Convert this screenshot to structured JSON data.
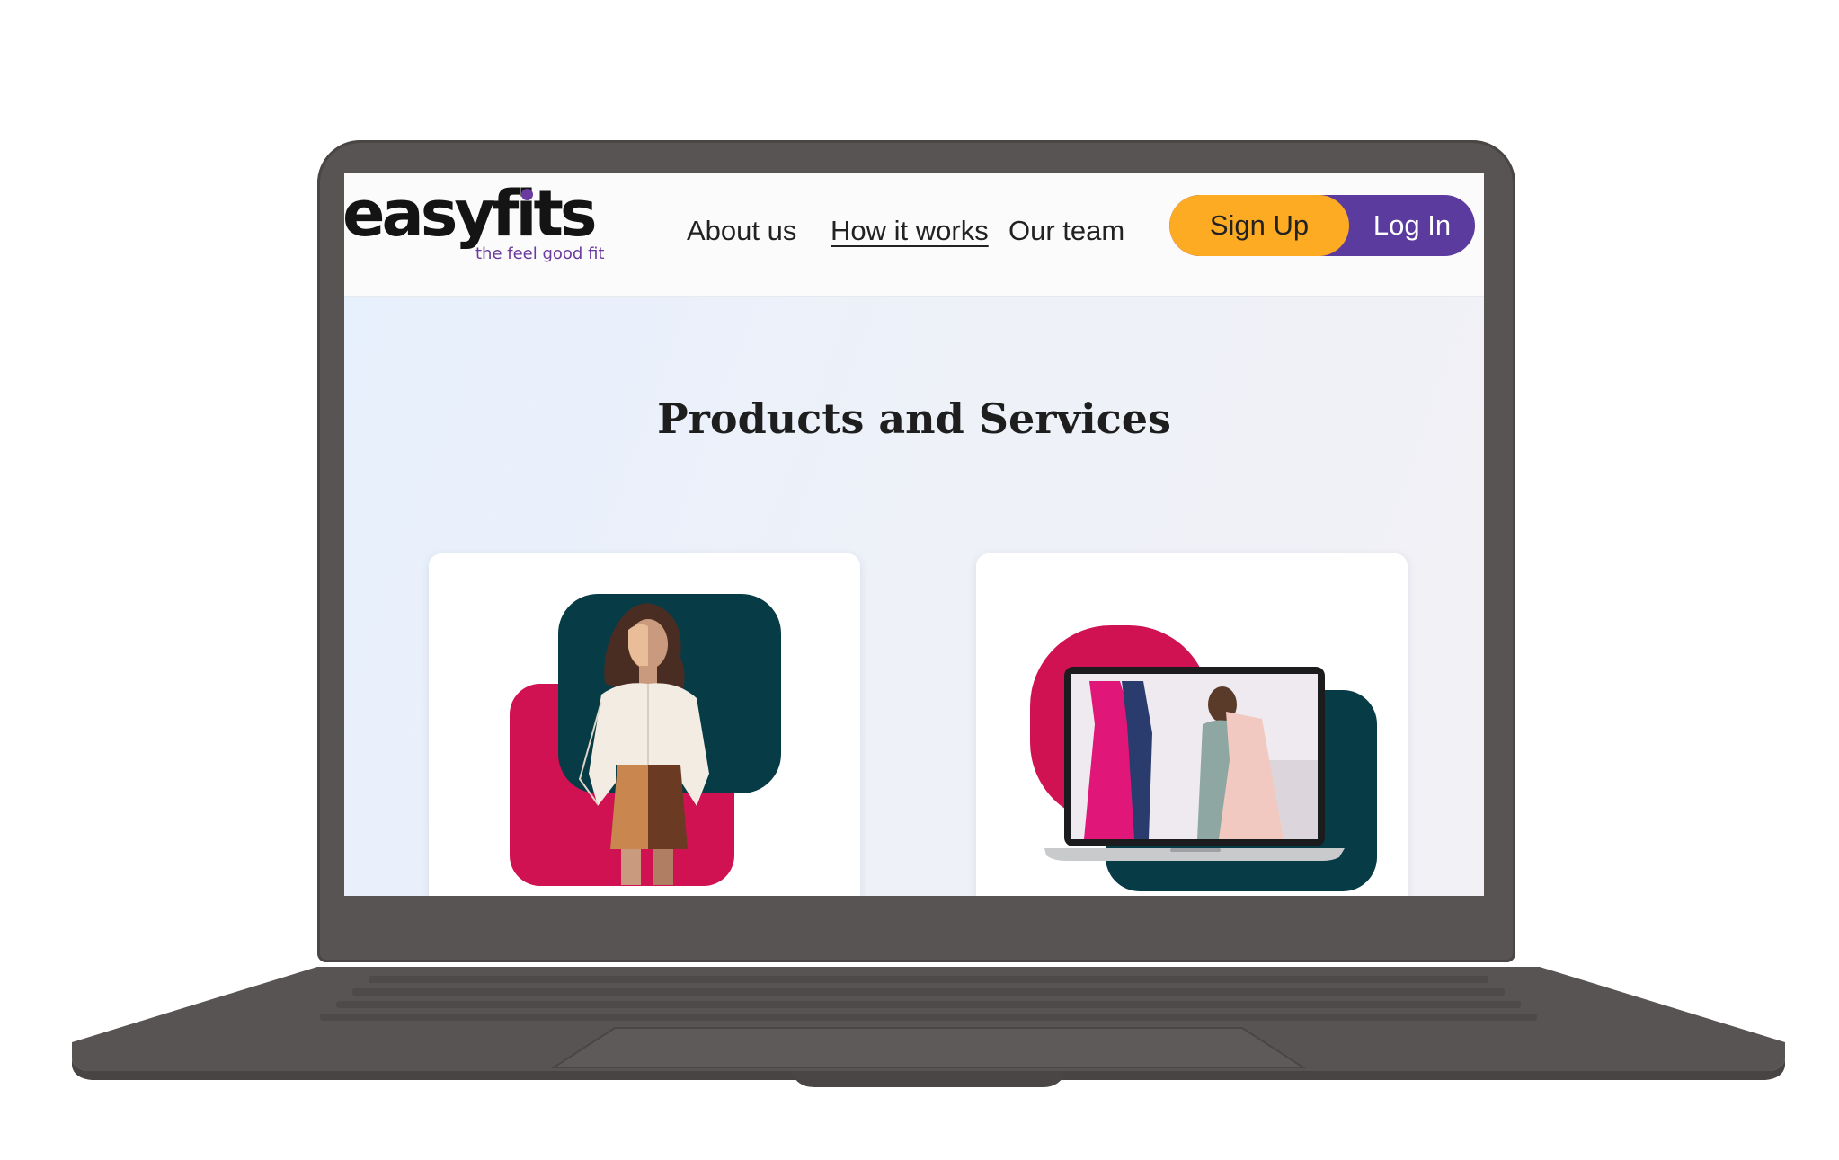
{
  "brand": {
    "name": "easyfits",
    "tagline": "the feel good fit",
    "accent_purple": "#5b3b9d",
    "accent_orange": "#fdab22",
    "accent_crimson": "#d01252",
    "accent_teal": "#073b46"
  },
  "nav": {
    "items": [
      {
        "label": "About us",
        "active": false
      },
      {
        "label": "How it works",
        "active": true
      },
      {
        "label": "Our team",
        "active": false
      }
    ]
  },
  "auth": {
    "signup_label": "Sign Up",
    "login_label": "Log In"
  },
  "main": {
    "section_title": "Products and Services",
    "cards": [
      {
        "image": "virtual-fitting-model-illustration"
      },
      {
        "image": "online-styling-laptop-illustration"
      }
    ]
  }
}
